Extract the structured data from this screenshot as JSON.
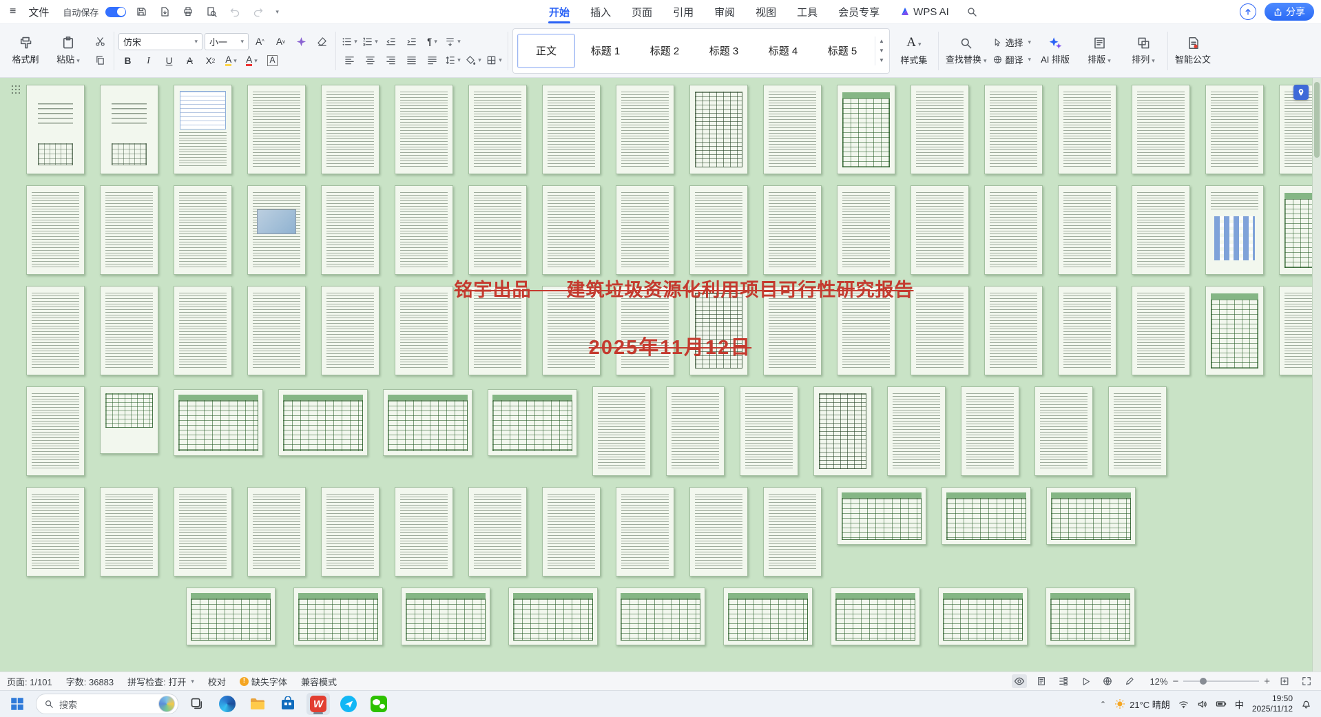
{
  "titlebar": {
    "file_menu": "文件",
    "autosave": "自动保存",
    "tabs": [
      {
        "label": "开始",
        "active": true
      },
      {
        "label": "插入"
      },
      {
        "label": "页面"
      },
      {
        "label": "引用"
      },
      {
        "label": "审阅"
      },
      {
        "label": "视图"
      },
      {
        "label": "工具"
      },
      {
        "label": "会员专享"
      }
    ],
    "ai_tab": "WPS AI",
    "share": "分享"
  },
  "ribbon": {
    "format_painter": "格式刷",
    "paste": "粘贴",
    "font_name": "仿宋",
    "font_size": "小一",
    "styles": [
      {
        "label": "正文",
        "active": true
      },
      {
        "label": "标题 1"
      },
      {
        "label": "标题 2"
      },
      {
        "label": "标题 3"
      },
      {
        "label": "标题 4"
      },
      {
        "label": "标题 5"
      }
    ],
    "style_set": "样式集",
    "find_replace": "查找替换",
    "select": "选择",
    "translate": "翻译",
    "ai_layout": "AI 排版",
    "layout": "排版",
    "arrange": "排列",
    "smart_doc": "智能公文"
  },
  "watermark": {
    "line1": "铭宇出品      建筑垃圾资源化利用项目可行性研究报告",
    "line2": "2025年11月12日",
    "color": "#c43a2e"
  },
  "document_grid": {
    "rows": [
      {
        "pages": [
          "cover",
          "cover",
          "form",
          "text",
          "text",
          "text",
          "text",
          "text",
          "text",
          "table",
          "text",
          "gtable",
          "text",
          "text",
          "text",
          "text",
          "text",
          "text"
        ]
      },
      {
        "pages": [
          "text",
          "text",
          "text",
          "image",
          "text",
          "text",
          "text",
          "text",
          "text",
          "text",
          "text",
          "text",
          "text",
          "text",
          "text",
          "text",
          "chart",
          "gtable"
        ]
      },
      {
        "pages": [
          "text",
          "text",
          "text",
          "text",
          "text",
          "text",
          "text",
          "text",
          "text",
          "table",
          "text",
          "text",
          "text",
          "text",
          "text",
          "text",
          "gtable",
          "text"
        ]
      },
      {
        "pages": [
          "text",
          "stable",
          "wtable",
          "wtable",
          "wtable",
          "wtable",
          "text",
          "text",
          "text",
          "table",
          "text",
          "text",
          "text",
          "text"
        ]
      },
      {
        "pages": [
          "text",
          "text",
          "text",
          "text",
          "text",
          "text",
          "text",
          "text",
          "text",
          "text",
          "text",
          "ltable",
          "ltable",
          "ltable"
        ]
      },
      {
        "indent": 270,
        "gap": 26,
        "pages": [
          "ltable",
          "ltable",
          "ltable",
          "ltable",
          "ltable",
          "ltable",
          "ltable",
          "ltable",
          "ltable"
        ]
      }
    ]
  },
  "statusbar": {
    "page": "页面: 1/101",
    "words": "字数: 36883",
    "spellcheck": "拼写检查: 打开",
    "proofread": "校对",
    "missing_fonts": "缺失字体",
    "compat_mode": "兼容模式",
    "zoom": "12%"
  },
  "taskbar": {
    "search": "搜索",
    "weather": "21°C 晴朗",
    "ime": "中",
    "time": "19:50",
    "date": "2025/11/12"
  }
}
